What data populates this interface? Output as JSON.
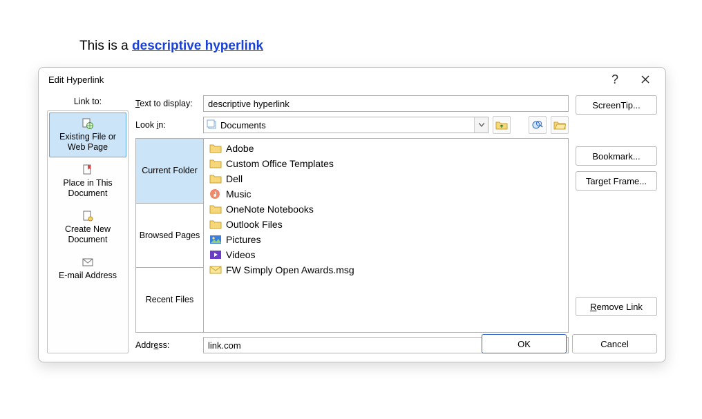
{
  "document": {
    "prefix": "This is a ",
    "link_text": "descriptive hyperlink"
  },
  "dialog": {
    "title": "Edit Hyperlink",
    "link_to_label": "Link to:",
    "link_to_items": [
      {
        "label": "Existing File or Web Page",
        "selected": true
      },
      {
        "label": "Place in This Document",
        "selected": false
      },
      {
        "label": "Create New Document",
        "selected": false
      },
      {
        "label": "E-mail Address",
        "selected": false
      }
    ],
    "text_to_display_label": "Text to display:",
    "text_to_display_value": "descriptive hyperlink",
    "look_in_label": "Look in:",
    "look_in_value": "Documents",
    "tabs": [
      {
        "label": "Current Folder",
        "selected": true
      },
      {
        "label": "Browsed Pages",
        "selected": false
      },
      {
        "label": "Recent Files",
        "selected": false
      }
    ],
    "files": [
      {
        "name": "Adobe",
        "icon": "folder"
      },
      {
        "name": "Custom Office Templates",
        "icon": "folder"
      },
      {
        "name": "Dell",
        "icon": "folder"
      },
      {
        "name": "Music",
        "icon": "music"
      },
      {
        "name": "OneNote Notebooks",
        "icon": "folder"
      },
      {
        "name": "Outlook Files",
        "icon": "folder"
      },
      {
        "name": "Pictures",
        "icon": "pictures"
      },
      {
        "name": "Videos",
        "icon": "videos"
      },
      {
        "name": "FW Simply Open Awards.msg",
        "icon": "mail"
      }
    ],
    "address_label": "Address:",
    "address_value": "link.com",
    "buttons": {
      "screentip": "ScreenTip...",
      "bookmark": "Bookmark...",
      "target_frame": "Target Frame...",
      "remove_link": "Remove Link",
      "ok": "OK",
      "cancel": "Cancel"
    }
  }
}
